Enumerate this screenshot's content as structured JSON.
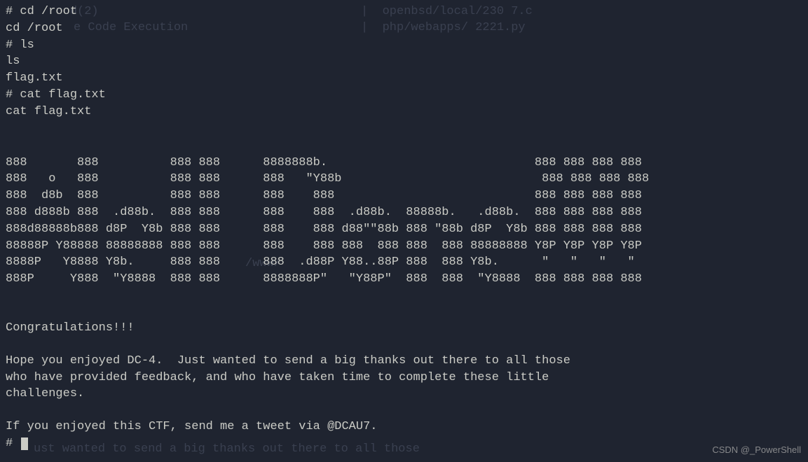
{
  "ghost": {
    "g1": "        cd(2)",
    "g2": "|  openbsd/local/230 7.c",
    "g3": "e Code Execution",
    "g4": "|  php/webapps/ 2221.py",
    "g5": "/www/",
    "g6": "ust wanted to send a big thanks out there to all those"
  },
  "lines": {
    "l1": "# cd /root",
    "l2": "cd /root",
    "l3": "# ls",
    "l4": "ls",
    "l5": "flag.txt",
    "l6": "# cat flag.txt",
    "l7": "cat flag.txt"
  },
  "ascii": {
    "a1": "888       888          888 888      8888888b.                             888 888 888 888",
    "a2": "888   o   888          888 888      888   \"Y88b                            888 888 888 888",
    "a3": "888  d8b  888          888 888      888    888                            888 888 888 888",
    "a4": "888 d888b 888  .d88b.  888 888      888    888  .d88b.  88888b.   .d88b.  888 888 888 888",
    "a5": "888d88888b888 d8P  Y8b 888 888      888    888 d88\"\"88b 888 \"88b d8P  Y8b 888 888 888 888",
    "a6": "88888P Y88888 88888888 888 888      888    888 888  888 888  888 88888888 Y8P Y8P Y8P Y8P",
    "a7": "8888P   Y8888 Y8b.     888 888      888  .d88P Y88..88P 888  888 Y8b.      \"   \"   \"   \" ",
    "a8": "888P     Y888  \"Y8888  888 888      8888888P\"   \"Y88P\"  888  888  \"Y8888  888 888 888 888"
  },
  "msg": {
    "m1": "Congratulations!!!",
    "m2": "Hope you enjoyed DC-4.  Just wanted to send a big thanks out there to all those",
    "m3": "who have provided feedback, and who have taken time to complete these little",
    "m4": "challenges.",
    "m5": "If you enjoyed this CTF, send me a tweet via @DCAU7.",
    "m6": "# "
  },
  "watermark": "CSDN @_PowerShell"
}
